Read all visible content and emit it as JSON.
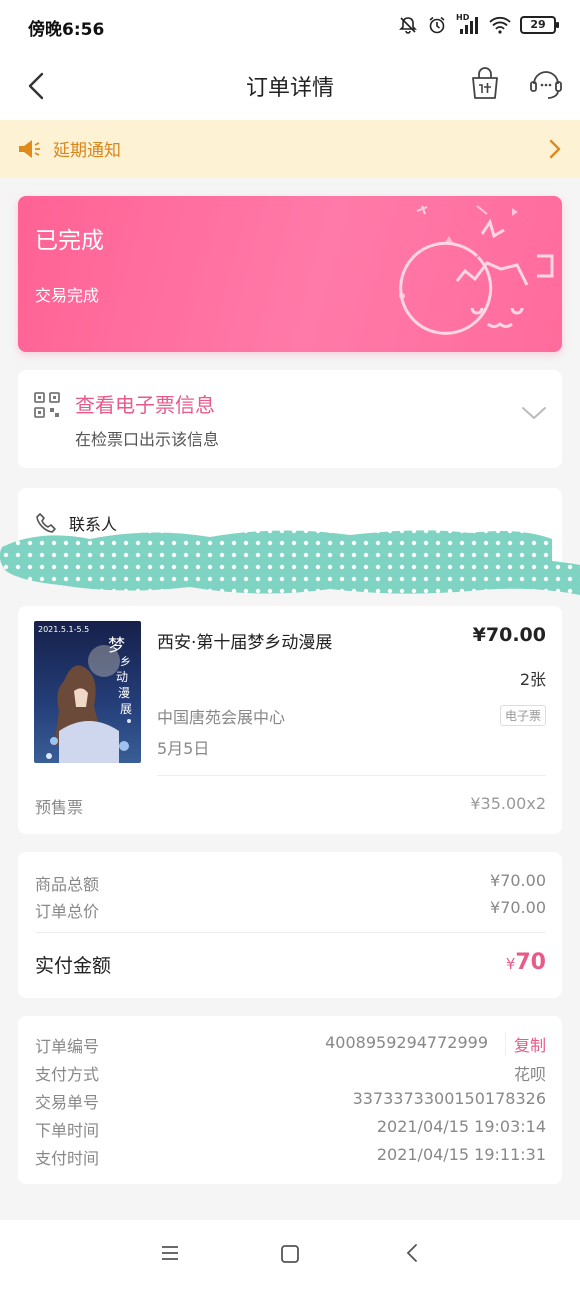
{
  "status_bar": {
    "time": "傍晚6:56",
    "battery": "29",
    "network_label": "HD"
  },
  "nav": {
    "title": "订单详情"
  },
  "notice": {
    "text": "延期通知"
  },
  "order_status": {
    "title": "已完成",
    "subtitle": "交易完成"
  },
  "eticket": {
    "title": "查看电子票信息",
    "subtitle": "在检票口出示该信息"
  },
  "contact": {
    "label": "联系人"
  },
  "item": {
    "title": "西安·第十届梦乡动漫展",
    "price": "¥70.00",
    "quantity": "2张",
    "venue": "中国唐苑会展中心",
    "tag": "电子票",
    "date": "5月5日",
    "ticket_type": "预售票",
    "unit_price": "¥35.00x2",
    "poster": {
      "date_text": "2021.5.1-5.5",
      "title_chars": [
        "梦",
        "乡",
        "动",
        "漫",
        "展"
      ]
    }
  },
  "summary": {
    "goods_total_label": "商品总额",
    "goods_total_value": "¥70.00",
    "order_total_label": "订单总价",
    "order_total_value": "¥70.00",
    "paid_label": "实付金额",
    "paid_currency": "¥",
    "paid_value": "70"
  },
  "details": {
    "order_no_label": "订单编号",
    "order_no_value": "4008959294772999",
    "copy_label": "复制",
    "pay_method_label": "支付方式",
    "pay_method_value": "花呗",
    "trade_no_label": "交易单号",
    "trade_no_value": "3373373300150178326",
    "order_time_label": "下单时间",
    "order_time_value": "2021/04/15 19:03:14",
    "pay_time_label": "支付时间",
    "pay_time_value": "2021/04/15 19:11:31"
  },
  "colors": {
    "accent_pink": "#e85a8c",
    "notice_orange": "#d8861c",
    "notice_bg": "#fdf2d4",
    "scribble_teal": "#7fd3c2"
  }
}
